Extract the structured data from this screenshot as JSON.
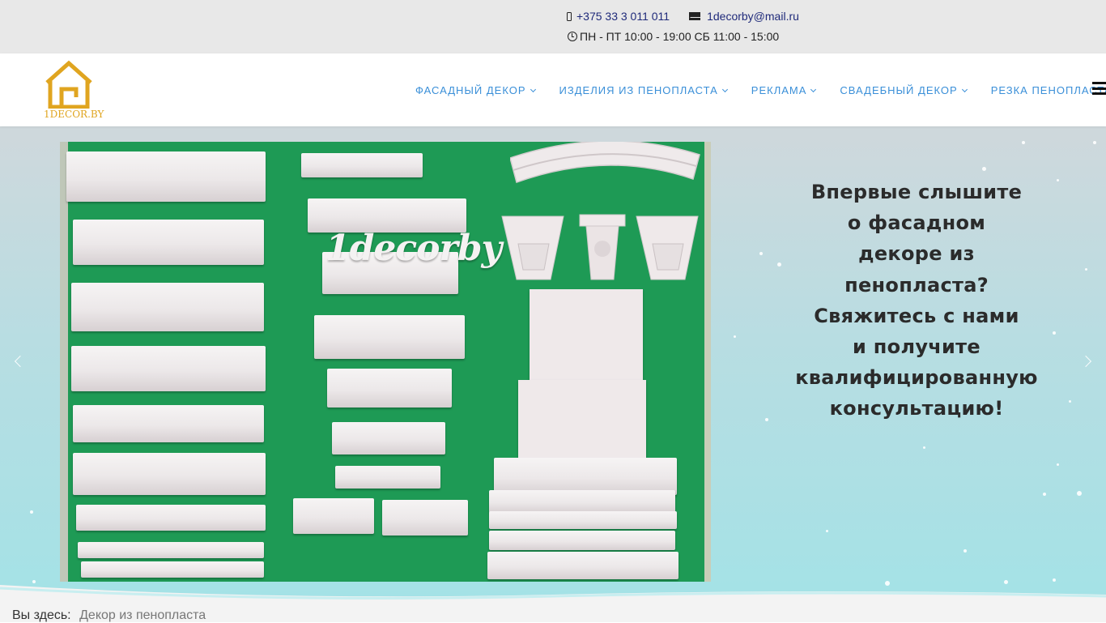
{
  "topbar": {
    "phone": "+375 33 3 011 011",
    "email": "1decorby@mail.ru",
    "hours": "ПН - ПТ 10:00 - 19:00 СБ 11:00 - 15:00",
    "icons": [
      "phone-icon",
      "envelope-icon",
      "clock-icon"
    ]
  },
  "header": {
    "logo_text": "1DECOR.BY",
    "nav": [
      {
        "label": "ФАСАДНЫЙ ДЕКОР",
        "has_dropdown": true
      },
      {
        "label": "ИЗДЕЛИЯ ИЗ ПЕНОПЛАСТА",
        "has_dropdown": true
      },
      {
        "label": "РЕКЛАМА",
        "has_dropdown": true
      },
      {
        "label": "СВАДЕБНЫЙ ДЕКОР",
        "has_dropdown": true
      },
      {
        "label": "РЕЗКА ПЕНОПЛАСТА",
        "has_dropdown": false
      }
    ],
    "menu_icon": "hamburger-icon"
  },
  "hero": {
    "photo_logo_text": "1decorby",
    "lines": [
      "Впервые слышите",
      "о фасадном",
      "декоре из",
      "пенопласта?",
      "Свяжитесь с нами",
      "и получите",
      "квалифицированную",
      "консультацию!"
    ]
  },
  "breadcrumb": {
    "label": "Вы здесь:",
    "current": "Декор из пенопласта"
  },
  "colors": {
    "accent": "#3a8fd8",
    "logo": "#e0a520",
    "contact_link": "#1f2a7a",
    "photo_board": "#1e9a55"
  }
}
